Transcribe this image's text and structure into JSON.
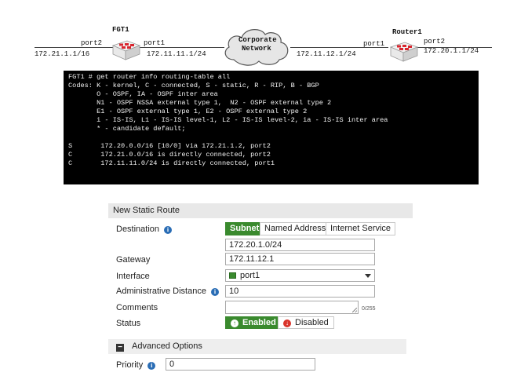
{
  "topology": {
    "fgt1": {
      "name": "FGT1",
      "left_port": "port2",
      "left_ip": "172.21.1.1/16",
      "right_port": "port1",
      "right_ip": "172.11.11.1/24"
    },
    "cloud": {
      "line1": "Corporate",
      "line2": "Network"
    },
    "router1": {
      "name": "Router1",
      "left_port": "port1",
      "left_ip": "172.11.12.1/24",
      "right_port": "port2",
      "right_ip": "172.20.1.1/24"
    }
  },
  "terminal": {
    "lines": [
      "FGT1 # get router info routing-table all",
      "Codes: K - kernel, C - connected, S - static, R - RIP, B - BGP",
      "       O - OSPF, IA - OSPF inter area",
      "       N1 - OSPF NSSA external type 1,  N2 - OSPF external type 2",
      "       E1 - OSPF external type 1, E2 - OSPF external type 2",
      "       i - IS-IS, L1 - IS-IS level-1, L2 - IS-IS level-2, ia - IS-IS inter area",
      "       * - candidate default;",
      "",
      "S       172.20.0.0/16 [10/0] via 172.21.1.2, port2",
      "C       172.21.0.0/16 is directly connected, port2",
      "C       172.11.11.0/24 is directly connected, port1"
    ]
  },
  "form": {
    "title": "New Static Route",
    "destination_label": "Destination",
    "dest_types": [
      "Subnet",
      "Named Address",
      "Internet Service"
    ],
    "destination_value": "172.20.1.0/24",
    "gateway_label": "Gateway",
    "gateway_value": "172.11.12.1",
    "interface_label": "Interface",
    "interface_value": "port1",
    "admin_distance_label": "Administrative Distance",
    "admin_distance_value": "10",
    "comments_label": "Comments",
    "comments_value": "",
    "comments_counter": "0/255",
    "status_label": "Status",
    "enabled_label": "Enabled",
    "disabled_label": "Disabled",
    "advanced_label": "Advanced Options",
    "priority_label": "Priority",
    "priority_value": "0"
  },
  "icons": {
    "info": "info-icon",
    "enabled": "check-icon",
    "disabled": "x-icon",
    "collapse": "minus-icon",
    "interface": "port-icon",
    "dropdown": "chevron-down-icon"
  },
  "colors": {
    "accent_green": "#3a8a2e",
    "info_blue": "#2a6db5",
    "disabled_red": "#d9342b",
    "terminal_bg": "#000000",
    "router_red": "#d8262f"
  }
}
